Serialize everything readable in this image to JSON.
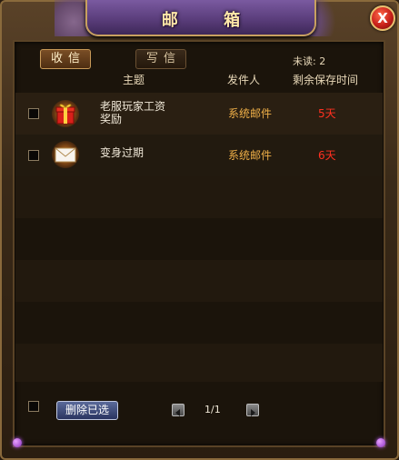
{
  "window": {
    "title": "邮 箱",
    "close_label": "X"
  },
  "tabs": {
    "inbox_label": "收信",
    "compose_label": "写信"
  },
  "unread_text": "未读: 2",
  "columns": {
    "subject": "主题",
    "sender": "发件人",
    "remaining": "剩余保存时间"
  },
  "mails": [
    {
      "subject_line1": "老服玩家工资",
      "subject_line2": "奖励",
      "sender": "系统邮件",
      "remaining": "5天",
      "icon": "gift-icon"
    },
    {
      "subject_line1": "变身过期",
      "subject_line2": "",
      "sender": "系统邮件",
      "remaining": "6天",
      "icon": "envelope-icon"
    }
  ],
  "footer": {
    "delete_label": "删除已选",
    "page_text": "1/1"
  },
  "colors": {
    "sender": "#f0b048",
    "remaining": "#ff3020",
    "title": "#ffe8a8"
  }
}
